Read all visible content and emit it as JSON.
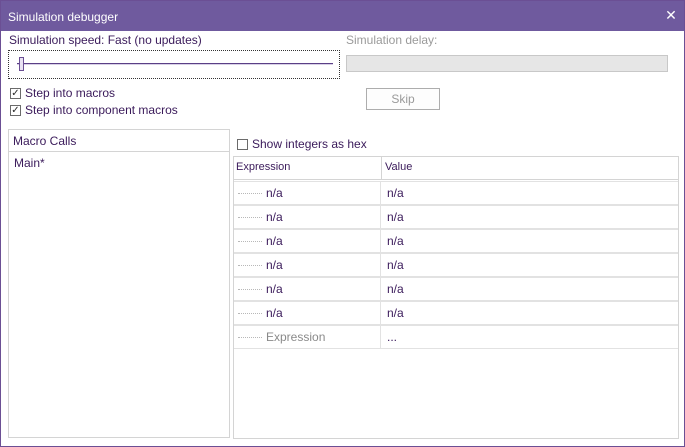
{
  "window": {
    "title": "Simulation debugger",
    "close_glyph": "✕"
  },
  "speed": {
    "label": "Simulation speed: Fast (no updates)"
  },
  "delay": {
    "label": "Simulation delay:"
  },
  "options": {
    "step_macros": {
      "label": "Step into macros",
      "checked": true
    },
    "step_component_macros": {
      "label": "Step into component macros",
      "checked": true
    },
    "show_hex": {
      "label": "Show integers as hex",
      "checked": false
    }
  },
  "skip_button": {
    "label": "Skip"
  },
  "macro_calls": {
    "header": "Macro Calls",
    "items": [
      "Main*"
    ]
  },
  "grid": {
    "headers": {
      "expression": "Expression",
      "value": "Value"
    },
    "rows": [
      {
        "expression": "n/a",
        "value": "n/a"
      },
      {
        "expression": "n/a",
        "value": "n/a"
      },
      {
        "expression": "n/a",
        "value": "n/a"
      },
      {
        "expression": "n/a",
        "value": "n/a"
      },
      {
        "expression": "n/a",
        "value": "n/a"
      },
      {
        "expression": "n/a",
        "value": "n/a"
      }
    ],
    "new_row": {
      "expression": "Expression",
      "value": "..."
    }
  },
  "colors": {
    "titlebar": "#6f5a9e",
    "text": "#3a1a5a"
  },
  "icons": {
    "close": "close-icon",
    "check": "checkmark-icon"
  }
}
